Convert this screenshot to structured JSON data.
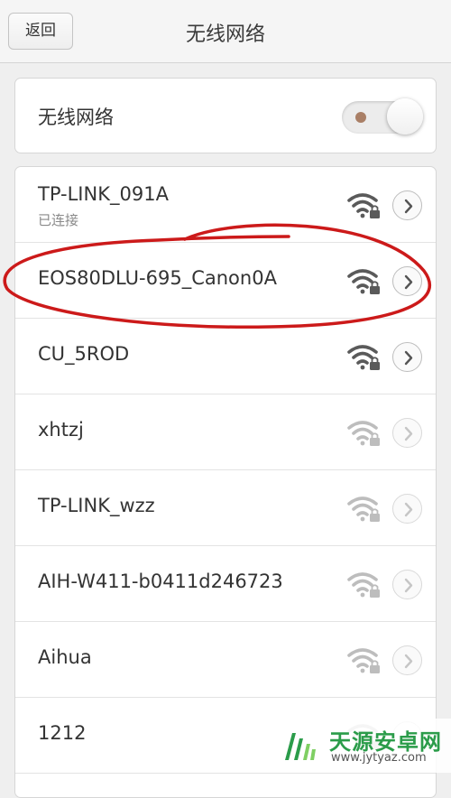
{
  "header": {
    "back_label": "返回",
    "title": "无线网络"
  },
  "toggle": {
    "label": "无线网络",
    "state": "on"
  },
  "networks": [
    {
      "name": "TP-LINK_091A",
      "status": "已连接",
      "secured": true,
      "signal": "strong"
    },
    {
      "name": "EOS80DLU-695_Canon0A",
      "status": "",
      "secured": true,
      "signal": "strong"
    },
    {
      "name": "CU_5ROD",
      "status": "",
      "secured": true,
      "signal": "strong"
    },
    {
      "name": "xhtzj",
      "status": "",
      "secured": true,
      "signal": "weak"
    },
    {
      "name": "TP-LINK_wzz",
      "status": "",
      "secured": true,
      "signal": "weak"
    },
    {
      "name": "AIH-W411-b0411d246723",
      "status": "",
      "secured": true,
      "signal": "weak"
    },
    {
      "name": "Aihua",
      "status": "",
      "secured": true,
      "signal": "weak"
    },
    {
      "name": "1212",
      "status": "",
      "secured": true,
      "signal": "weak"
    }
  ],
  "icons": {
    "wifi": "wifi-lock-icon",
    "detail": "chevron-right-icon"
  },
  "colors": {
    "annotation": "#cc1a1a",
    "wifi_strong": "#5a5a5a",
    "wifi_weak": "#bdbdbd"
  },
  "watermark": {
    "name": "天源安卓网",
    "url": "www.jytyaz.com"
  }
}
